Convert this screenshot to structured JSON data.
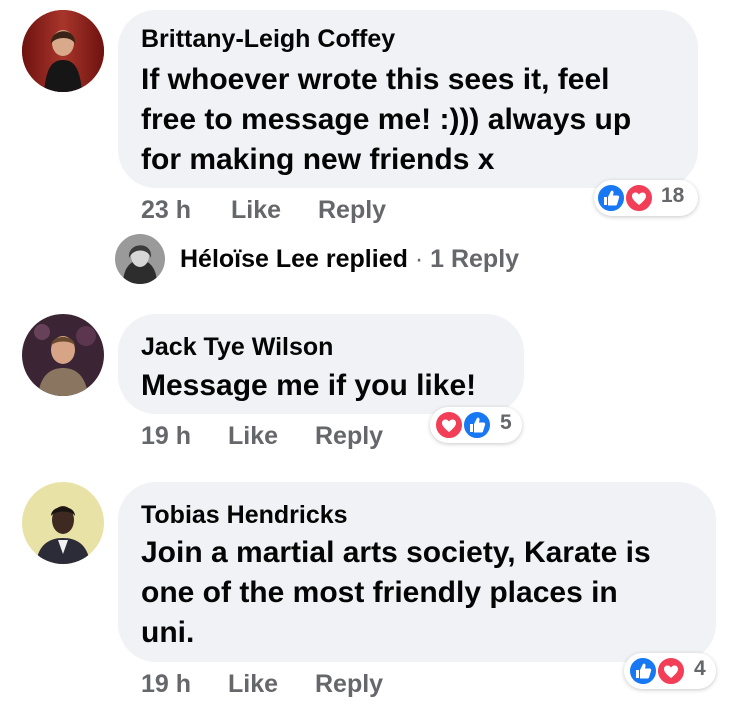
{
  "comments": [
    {
      "author": "Brittany-Leigh Coffey",
      "text_lines": [
        "If whoever wrote this sees it, feel",
        "free to message me! :))) always up",
        "for making new friends x"
      ],
      "time": "23 h",
      "like_label": "Like",
      "reply_label": "Reply",
      "reaction_count": "18",
      "reactions": [
        "like-icon",
        "love-icon"
      ]
    },
    {
      "author": "Jack Tye Wilson",
      "text_lines": [
        "Message me if you like!"
      ],
      "time": "19 h",
      "like_label": "Like",
      "reply_label": "Reply",
      "reaction_count": "5",
      "reactions": [
        "love-icon",
        "like-icon"
      ]
    },
    {
      "author": "Tobias Hendricks",
      "text_lines": [
        "Join a martial arts society, Karate is",
        "one of the most friendly places in",
        "uni."
      ],
      "time": "19 h",
      "like_label": "Like",
      "reply_label": "Reply",
      "reaction_count": "4",
      "reactions": [
        "like-icon",
        "love-icon"
      ]
    }
  ],
  "reply_summary": {
    "name": "Héloïse Lee",
    "action": "replied",
    "separator": "·",
    "link": "1 Reply"
  },
  "colors": {
    "bubble": "#f0f2f5",
    "meta": "#65676b",
    "like_blue": "#1877f2",
    "love_red": "#f33e58"
  }
}
